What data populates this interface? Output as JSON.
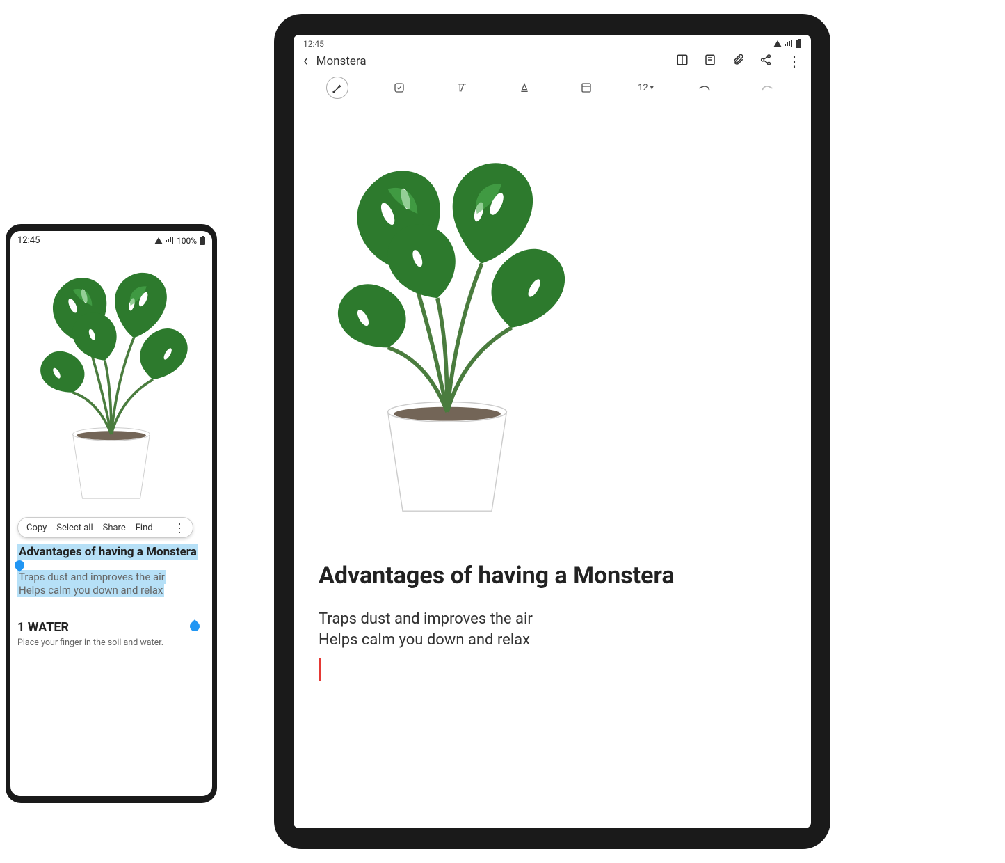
{
  "phone": {
    "status": {
      "time": "12:45",
      "battery": "100%"
    },
    "context_menu": {
      "copy": "Copy",
      "select_all": "Select all",
      "share": "Share",
      "find": "Find"
    },
    "heading": "Advantages of having a Monstera",
    "body1": "Traps dust and improves the air",
    "body2": "Helps calm you down and relax",
    "section": {
      "title": "1  WATER",
      "body": "Place your finger in the soil and water."
    }
  },
  "tablet": {
    "status": {
      "time": "12:45"
    },
    "header": {
      "title": "Monstera"
    },
    "toolbar": {
      "font_size": "12"
    },
    "heading": "Advantages of having a Monstera",
    "body1": "Traps dust and improves the air",
    "body2": "Helps calm you down and relax"
  }
}
